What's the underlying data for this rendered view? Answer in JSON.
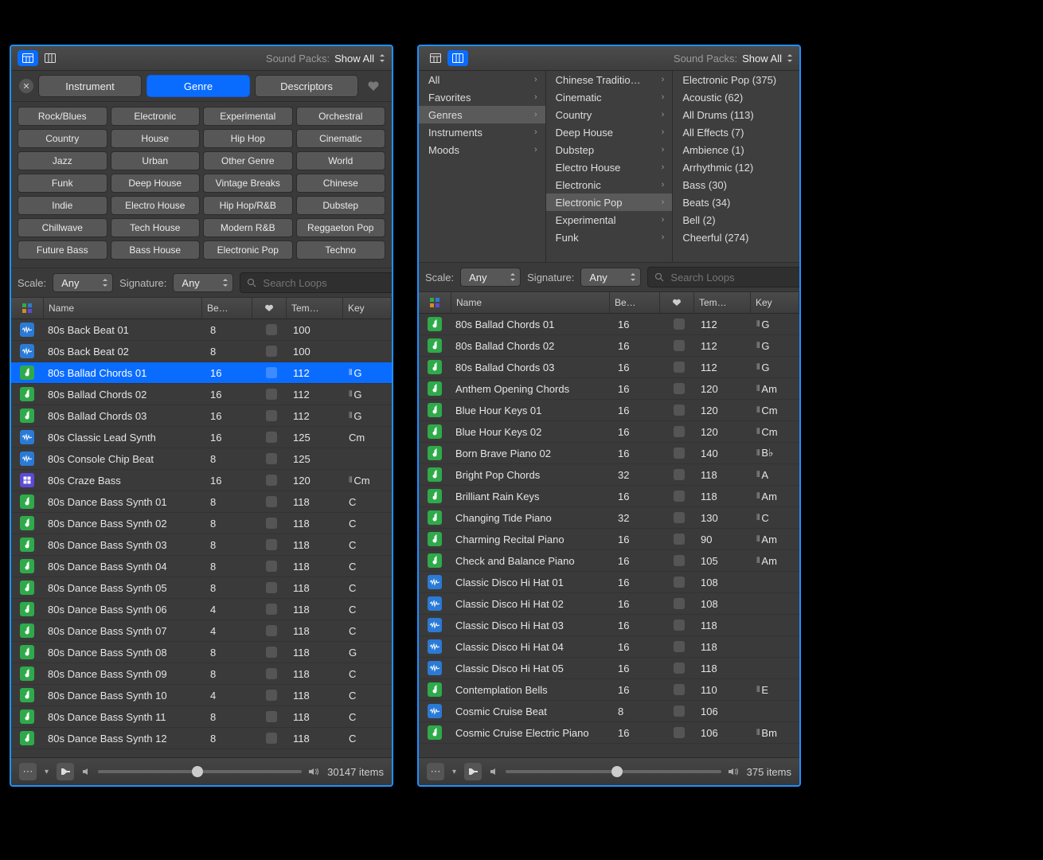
{
  "soundpacks_label": "Sound Packs:",
  "soundpacks_value": "Show All",
  "tabs": {
    "instrument": "Instrument",
    "genre": "Genre",
    "descriptors": "Descriptors"
  },
  "tags": [
    "Rock/Blues",
    "Electronic",
    "Experimental",
    "Orchestral",
    "Country",
    "House",
    "Hip Hop",
    "Cinematic",
    "Jazz",
    "Urban",
    "Other Genre",
    "World",
    "Funk",
    "Deep House",
    "Vintage Breaks",
    "Chinese",
    "Indie",
    "Electro House",
    "Hip Hop/R&B",
    "Dubstep",
    "Chillwave",
    "Tech House",
    "Modern R&B",
    "Reggaeton Pop",
    "Future Bass",
    "Bass House",
    "Electronic Pop",
    "Techno"
  ],
  "filters": {
    "scale_label": "Scale:",
    "scale_value": "Any",
    "sig_label": "Signature:",
    "sig_value": "Any",
    "search_placeholder": "Search Loops"
  },
  "columns": {
    "name": "Name",
    "beats": "Be…",
    "fav": "♥",
    "tempo": "Tem…",
    "key": "Key"
  },
  "left_rows": [
    {
      "ic": "blue",
      "name": "80s Back Beat 01",
      "be": "8",
      "tempo": "100",
      "key": "",
      "kg": false
    },
    {
      "ic": "blue",
      "name": "80s Back Beat 02",
      "be": "8",
      "tempo": "100",
      "key": "",
      "kg": false
    },
    {
      "ic": "green",
      "name": "80s Ballad Chords 01",
      "be": "16",
      "tempo": "112",
      "key": "G",
      "kg": true,
      "sel": true
    },
    {
      "ic": "green",
      "name": "80s Ballad Chords 02",
      "be": "16",
      "tempo": "112",
      "key": "G",
      "kg": true
    },
    {
      "ic": "green",
      "name": "80s Ballad Chords 03",
      "be": "16",
      "tempo": "112",
      "key": "G",
      "kg": true
    },
    {
      "ic": "blue",
      "name": "80s Classic Lead Synth",
      "be": "16",
      "tempo": "125",
      "key": "Cm",
      "kg": false
    },
    {
      "ic": "blue",
      "name": "80s Console Chip Beat",
      "be": "8",
      "tempo": "125",
      "key": "",
      "kg": false
    },
    {
      "ic": "purple",
      "name": "80s Craze Bass",
      "be": "16",
      "tempo": "120",
      "key": "Cm",
      "kg": true
    },
    {
      "ic": "green",
      "name": "80s Dance Bass Synth 01",
      "be": "8",
      "tempo": "118",
      "key": "C",
      "kg": false
    },
    {
      "ic": "green",
      "name": "80s Dance Bass Synth 02",
      "be": "8",
      "tempo": "118",
      "key": "C",
      "kg": false
    },
    {
      "ic": "green",
      "name": "80s Dance Bass Synth 03",
      "be": "8",
      "tempo": "118",
      "key": "C",
      "kg": false
    },
    {
      "ic": "green",
      "name": "80s Dance Bass Synth 04",
      "be": "8",
      "tempo": "118",
      "key": "C",
      "kg": false
    },
    {
      "ic": "green",
      "name": "80s Dance Bass Synth 05",
      "be": "8",
      "tempo": "118",
      "key": "C",
      "kg": false
    },
    {
      "ic": "green",
      "name": "80s Dance Bass Synth 06",
      "be": "4",
      "tempo": "118",
      "key": "C",
      "kg": false
    },
    {
      "ic": "green",
      "name": "80s Dance Bass Synth 07",
      "be": "4",
      "tempo": "118",
      "key": "C",
      "kg": false
    },
    {
      "ic": "green",
      "name": "80s Dance Bass Synth 08",
      "be": "8",
      "tempo": "118",
      "key": "G",
      "kg": false
    },
    {
      "ic": "green",
      "name": "80s Dance Bass Synth 09",
      "be": "8",
      "tempo": "118",
      "key": "C",
      "kg": false
    },
    {
      "ic": "green",
      "name": "80s Dance Bass Synth 10",
      "be": "4",
      "tempo": "118",
      "key": "C",
      "kg": false
    },
    {
      "ic": "green",
      "name": "80s Dance Bass Synth 11",
      "be": "8",
      "tempo": "118",
      "key": "C",
      "kg": false
    },
    {
      "ic": "green",
      "name": "80s Dance Bass Synth 12",
      "be": "8",
      "tempo": "118",
      "key": "C",
      "kg": false
    }
  ],
  "left_count": "30147 items",
  "left_vol_pos": "46%",
  "col1": [
    {
      "label": "All",
      "arr": true
    },
    {
      "label": "Favorites",
      "arr": true
    },
    {
      "label": "Genres",
      "arr": true,
      "sel": true
    },
    {
      "label": "Instruments",
      "arr": true
    },
    {
      "label": "Moods",
      "arr": true
    }
  ],
  "col2": [
    {
      "label": "Chinese Traditio…",
      "arr": true
    },
    {
      "label": "Cinematic",
      "arr": true
    },
    {
      "label": "Country",
      "arr": true
    },
    {
      "label": "Deep House",
      "arr": true
    },
    {
      "label": "Dubstep",
      "arr": true
    },
    {
      "label": "Electro House",
      "arr": true
    },
    {
      "label": "Electronic",
      "arr": true
    },
    {
      "label": "Electronic Pop",
      "arr": true,
      "sel": true
    },
    {
      "label": "Experimental",
      "arr": true
    },
    {
      "label": "Funk",
      "arr": true
    }
  ],
  "col3": [
    {
      "label": "Electronic Pop (375)"
    },
    {
      "label": "Acoustic (62)"
    },
    {
      "label": "All Drums (113)"
    },
    {
      "label": "All Effects (7)"
    },
    {
      "label": "Ambience (1)"
    },
    {
      "label": "Arrhythmic (12)"
    },
    {
      "label": "Bass (30)"
    },
    {
      "label": "Beats (34)"
    },
    {
      "label": "Bell (2)"
    },
    {
      "label": "Cheerful (274)"
    }
  ],
  "right_rows": [
    {
      "ic": "green",
      "name": "80s Ballad Chords 01",
      "be": "16",
      "tempo": "112",
      "key": "G",
      "kg": true
    },
    {
      "ic": "green",
      "name": "80s Ballad Chords 02",
      "be": "16",
      "tempo": "112",
      "key": "G",
      "kg": true
    },
    {
      "ic": "green",
      "name": "80s Ballad Chords 03",
      "be": "16",
      "tempo": "112",
      "key": "G",
      "kg": true
    },
    {
      "ic": "green",
      "name": "Anthem Opening Chords",
      "be": "16",
      "tempo": "120",
      "key": "Am",
      "kg": true
    },
    {
      "ic": "green",
      "name": "Blue Hour Keys 01",
      "be": "16",
      "tempo": "120",
      "key": "Cm",
      "kg": true
    },
    {
      "ic": "green",
      "name": "Blue Hour Keys 02",
      "be": "16",
      "tempo": "120",
      "key": "Cm",
      "kg": true
    },
    {
      "ic": "green",
      "name": "Born Brave Piano 02",
      "be": "16",
      "tempo": "140",
      "key": "B♭",
      "kg": true
    },
    {
      "ic": "green",
      "name": "Bright Pop Chords",
      "be": "32",
      "tempo": "118",
      "key": "A",
      "kg": true
    },
    {
      "ic": "green",
      "name": "Brilliant Rain Keys",
      "be": "16",
      "tempo": "118",
      "key": "Am",
      "kg": true
    },
    {
      "ic": "green",
      "name": "Changing Tide Piano",
      "be": "32",
      "tempo": "130",
      "key": "C",
      "kg": true
    },
    {
      "ic": "green",
      "name": "Charming Recital Piano",
      "be": "16",
      "tempo": "90",
      "key": "Am",
      "kg": true
    },
    {
      "ic": "green",
      "name": "Check and Balance Piano",
      "be": "16",
      "tempo": "105",
      "key": "Am",
      "kg": true
    },
    {
      "ic": "blue",
      "name": "Classic Disco Hi Hat 01",
      "be": "16",
      "tempo": "108",
      "key": "",
      "kg": false
    },
    {
      "ic": "blue",
      "name": "Classic Disco Hi Hat 02",
      "be": "16",
      "tempo": "108",
      "key": "",
      "kg": false
    },
    {
      "ic": "blue",
      "name": "Classic Disco Hi Hat 03",
      "be": "16",
      "tempo": "118",
      "key": "",
      "kg": false
    },
    {
      "ic": "blue",
      "name": "Classic Disco Hi Hat 04",
      "be": "16",
      "tempo": "118",
      "key": "",
      "kg": false
    },
    {
      "ic": "blue",
      "name": "Classic Disco Hi Hat 05",
      "be": "16",
      "tempo": "118",
      "key": "",
      "kg": false
    },
    {
      "ic": "green",
      "name": "Contemplation Bells",
      "be": "16",
      "tempo": "110",
      "key": "E",
      "kg": true
    },
    {
      "ic": "blue",
      "name": "Cosmic Cruise Beat",
      "be": "8",
      "tempo": "106",
      "key": "",
      "kg": false
    },
    {
      "ic": "green",
      "name": "Cosmic Cruise Electric Piano",
      "be": "16",
      "tempo": "106",
      "key": "Bm",
      "kg": true
    }
  ],
  "right_count": "375 items",
  "right_vol_pos": "49%"
}
